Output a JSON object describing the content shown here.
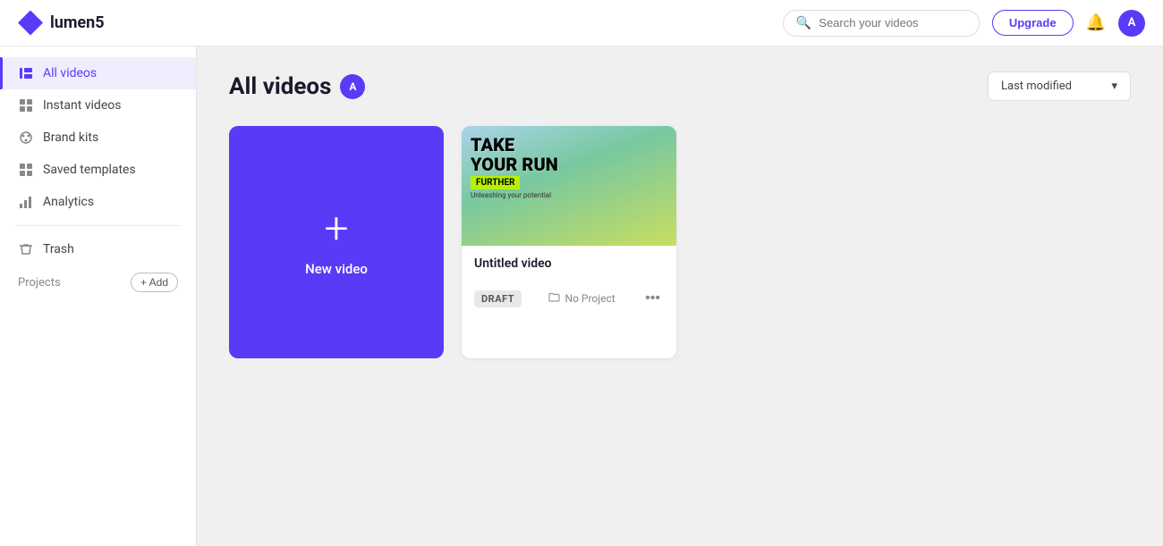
{
  "app": {
    "name": "lumen5"
  },
  "topnav": {
    "logo_text": "lumen5",
    "search_placeholder": "Search your videos",
    "upgrade_label": "Upgrade",
    "avatar_initial": "A"
  },
  "sidebar": {
    "items": [
      {
        "id": "all-videos",
        "label": "All videos",
        "icon": "▶",
        "active": true
      },
      {
        "id": "instant-videos",
        "label": "Instant videos",
        "icon": "⊞",
        "active": false
      },
      {
        "id": "brand-kits",
        "label": "Brand kits",
        "icon": "🎨",
        "active": false
      },
      {
        "id": "saved-templates",
        "label": "Saved templates",
        "icon": "⊞",
        "active": false
      },
      {
        "id": "analytics",
        "label": "Analytics",
        "icon": "📊",
        "active": false
      },
      {
        "id": "trash",
        "label": "Trash",
        "icon": "🗑",
        "active": false
      }
    ],
    "projects_label": "Projects",
    "add_label": "+ Add"
  },
  "content": {
    "title": "All videos",
    "user_avatar": "A",
    "sort_label": "Last modified",
    "sort_chevron": "▾"
  },
  "videos": {
    "new_video": {
      "plus": "+",
      "label": "New video"
    },
    "items": [
      {
        "id": "untitled-video",
        "title": "Untitled video",
        "status": "DRAFT",
        "project": "No Project",
        "thumbnail_lines": [
          "TAKE",
          "YOUR RUN",
          "FURTHER"
        ],
        "sub_text": "Unleashing your potential"
      }
    ]
  }
}
